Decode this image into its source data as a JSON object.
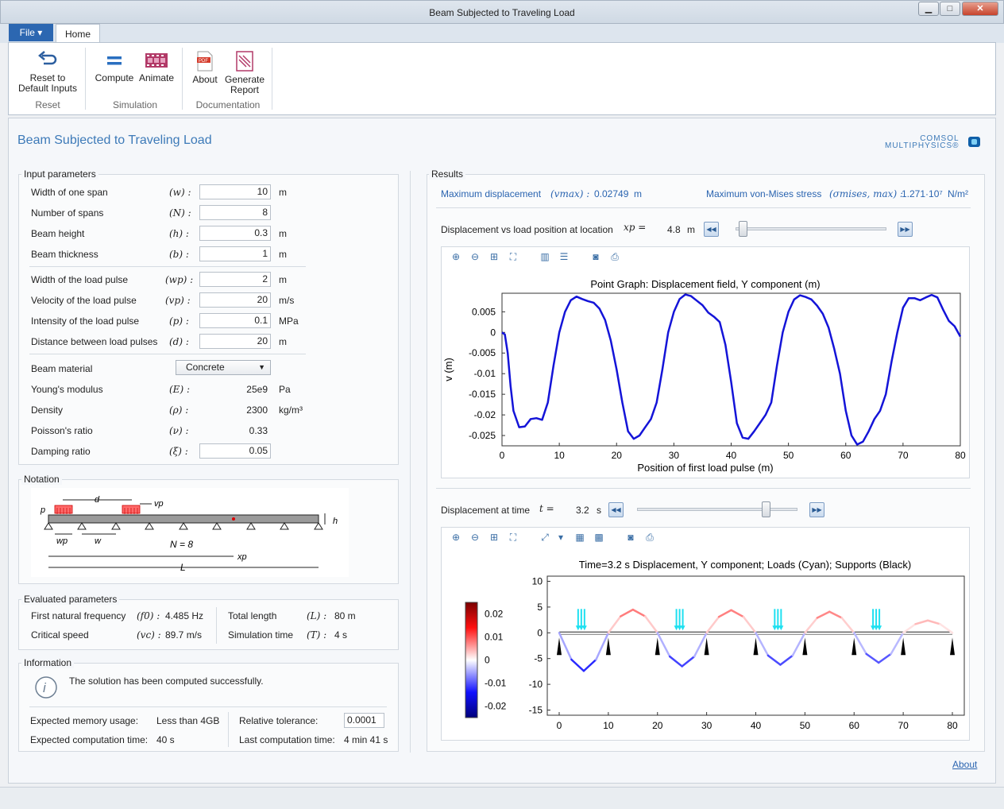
{
  "window": {
    "title": "Beam Subjected to Traveling Load",
    "min": "▁",
    "max": "□",
    "close": "✕"
  },
  "ribbon": {
    "file_label": "File ▾",
    "home_tab": "Home",
    "buttons": {
      "reset": "Reset to\nDefault Inputs",
      "compute": "Compute",
      "animate": "Animate",
      "about": "About",
      "report": "Generate\nReport"
    },
    "groups": {
      "reset": "Reset",
      "simulation": "Simulation",
      "documentation": "Documentation"
    }
  },
  "app": {
    "title": "Beam Subjected to Traveling Load",
    "logo_top": "COMSOL",
    "logo_bottom": "MULTIPHYSICS®"
  },
  "inputs": {
    "title": "Input parameters",
    "rows": [
      {
        "label": "Width of one span",
        "sym": "(w) :",
        "value": "10",
        "unit": "m"
      },
      {
        "label": "Number of spans",
        "sym": "(N) :",
        "value": "8",
        "unit": ""
      },
      {
        "label": "Beam height",
        "sym": "(h) :",
        "value": "0.3",
        "unit": "m"
      },
      {
        "label": "Beam thickness",
        "sym": "(b) :",
        "value": "1",
        "unit": "m"
      },
      {
        "label": "Width of the load pulse",
        "sym": "(wp) :",
        "value": "2",
        "unit": "m"
      },
      {
        "label": "Velocity of the load pulse",
        "sym": "(vp) :",
        "value": "20",
        "unit": "m/s"
      },
      {
        "label": "Intensity of the load pulse",
        "sym": "(p) :",
        "value": "0.1",
        "unit": "MPa"
      },
      {
        "label": "Distance between load pulses",
        "sym": "(d) :",
        "value": "20",
        "unit": "m"
      }
    ],
    "material_label": "Beam material",
    "material_value": "Concrete",
    "props": [
      {
        "label": "Young's modulus",
        "sym": "(E) :",
        "value": "25e9",
        "unit": "Pa"
      },
      {
        "label": "Density",
        "sym": "(ρ) :",
        "value": "2300",
        "unit": "kg/m³"
      },
      {
        "label": "Poisson's ratio",
        "sym": "(ν) :",
        "value": "0.33",
        "unit": ""
      }
    ],
    "damping": {
      "label": "Damping ratio",
      "sym": "(ξ) :",
      "value": "0.05"
    }
  },
  "notation": {
    "title": "Notation",
    "d": "d",
    "vp": "vp",
    "p": "p",
    "h": "h",
    "wp": "wp",
    "w": "w",
    "N": "N = 8",
    "xp": "xp",
    "L": "L"
  },
  "evaluated": {
    "title": "Evaluated parameters",
    "f0_label": "First natural frequency",
    "f0_sym": "(f0) :",
    "f0_value": "4.485 Hz",
    "vc_label": "Critical speed",
    "vc_sym": "(vc) :",
    "vc_value": "89.7 m/s",
    "L_label": "Total length",
    "L_sym": "(L) :",
    "L_value": "80 m",
    "T_label": "Simulation time",
    "T_sym": "(T) :",
    "T_value": "4 s"
  },
  "information": {
    "title": "Information",
    "icon": "info-icon",
    "message": "The solution has been computed successfully.",
    "mem_label": "Expected memory usage:",
    "mem_value": "Less than 4GB",
    "time_label": "Expected computation time:",
    "time_value": "40 s",
    "tol_label": "Relative tolerance:",
    "tol_value": "0.0001",
    "last_label": "Last computation time:",
    "last_value": "4 min 41 s"
  },
  "results": {
    "title": "Results",
    "maxdisp_label": "Maximum displacement",
    "maxdisp_sym": "(vmax) :",
    "maxdisp_value": "0.02749",
    "maxdisp_unit": "m",
    "maxstress_label": "Maximum von-Mises stress",
    "maxstress_sym": "(σmises, max) :",
    "maxstress_value": "1.271·10⁷",
    "maxstress_unit": "N/m²",
    "loc_label": "Displacement vs load position at location",
    "loc_sym": "xp =",
    "loc_value": "4.8",
    "loc_unit": "m",
    "loc_slider": 0.02,
    "time_label": "Displacement at time",
    "time_sym": "t =",
    "time_value": "3.2",
    "time_unit": "s",
    "time_slider": 0.8
  },
  "chart_data": [
    {
      "type": "line",
      "title": "Point Graph: Displacement field, Y component (m)",
      "xlabel": "Position of first load pulse (m)",
      "ylabel": "v (m)",
      "xlim": [
        0,
        80
      ],
      "ylim": [
        -0.0275,
        0.0095
      ],
      "xticks": [
        "0",
        "10",
        "20",
        "30",
        "40",
        "50",
        "60",
        "70",
        "80"
      ],
      "yticks": [
        "0.005",
        "0",
        "-0.005",
        "-0.01",
        "-0.015",
        "-0.02",
        "-0.025"
      ],
      "series": [
        {
          "color": "#1414d8",
          "x": [
            0,
            0.5,
            1,
            1.5,
            2,
            3,
            4,
            5,
            6,
            7,
            8,
            9,
            10,
            11,
            12,
            13,
            14,
            15,
            16,
            17,
            18,
            19,
            20,
            21,
            22,
            23,
            24,
            25,
            26,
            27,
            28,
            29,
            30,
            31,
            32,
            33,
            34,
            35,
            36,
            37,
            38,
            39,
            40,
            41,
            42,
            43,
            44,
            45,
            46,
            47,
            48,
            49,
            50,
            51,
            52,
            53,
            54,
            55,
            56,
            57,
            58,
            59,
            60,
            61,
            62,
            63,
            64,
            65,
            66,
            67,
            68,
            69,
            70,
            71,
            72,
            73,
            74,
            75,
            76,
            77,
            78,
            79,
            80
          ],
          "y": [
            0,
            -0.0005,
            -0.005,
            -0.013,
            -0.019,
            -0.023,
            -0.0228,
            -0.021,
            -0.0208,
            -0.0212,
            -0.017,
            -0.008,
            0.0,
            0.005,
            0.0078,
            0.0087,
            0.0081,
            0.0076,
            0.0072,
            0.0058,
            0.003,
            -0.002,
            -0.009,
            -0.017,
            -0.024,
            -0.0258,
            -0.025,
            -0.023,
            -0.021,
            -0.017,
            -0.009,
            0.0,
            0.005,
            0.0081,
            0.0092,
            0.0088,
            0.0077,
            0.0066,
            0.0048,
            0.0038,
            0.0025,
            -0.003,
            -0.012,
            -0.022,
            -0.0255,
            -0.0258,
            -0.024,
            -0.022,
            -0.02,
            -0.017,
            -0.008,
            0.0,
            0.005,
            0.008,
            0.009,
            0.0086,
            0.008,
            0.0065,
            0.0045,
            0.0012,
            -0.004,
            -0.01,
            -0.019,
            -0.025,
            -0.0272,
            -0.0265,
            -0.024,
            -0.021,
            -0.019,
            -0.015,
            -0.007,
            0.0,
            0.006,
            0.0083,
            0.0083,
            0.0078,
            0.0085,
            0.0091,
            0.0085,
            0.0055,
            0.0028,
            0.0015,
            -0.001
          ]
        }
      ]
    },
    {
      "type": "line",
      "title": "Time=3.2 s Displacement, Y component; Loads (Cyan); Supports (Black)",
      "xlim": [
        0,
        80
      ],
      "ylim": [
        -16,
        11
      ],
      "xticks": [
        "0",
        "10",
        "20",
        "30",
        "40",
        "50",
        "60",
        "70",
        "80"
      ],
      "yticks": [
        "10",
        "5",
        "0",
        "-5",
        "-10",
        "-15"
      ],
      "colorbar": {
        "ticks": [
          "0.02",
          "0.01",
          "0",
          "-0.01",
          "-0.02"
        ],
        "range": [
          -0.025,
          0.025
        ]
      },
      "supports_x": [
        0,
        10,
        20,
        30,
        40,
        50,
        60,
        70,
        80
      ],
      "loads_x": [
        4.5,
        24.5,
        44.5,
        64.5
      ],
      "beam": {
        "x": [
          0,
          2.5,
          5,
          7.5,
          10,
          12.5,
          15,
          17.5,
          20,
          22.5,
          25,
          27.5,
          30,
          32.5,
          35,
          37.5,
          40,
          42.5,
          45,
          47.5,
          50,
          52.5,
          55,
          57.5,
          60,
          62.5,
          65,
          67.5,
          70,
          72.5,
          75,
          77.5,
          80
        ],
        "y": [
          0,
          -5.2,
          -7.4,
          -5.2,
          0,
          3.2,
          4.5,
          3.2,
          0,
          -4.6,
          -6.5,
          -4.6,
          0,
          3.1,
          4.4,
          3.1,
          0,
          -4.4,
          -6.2,
          -4.4,
          0,
          2.9,
          4.1,
          2.9,
          0,
          -4.1,
          -5.8,
          -4.1,
          0,
          1.7,
          2.4,
          1.7,
          0
        ]
      }
    }
  ],
  "footer": {
    "about_link": "About"
  }
}
